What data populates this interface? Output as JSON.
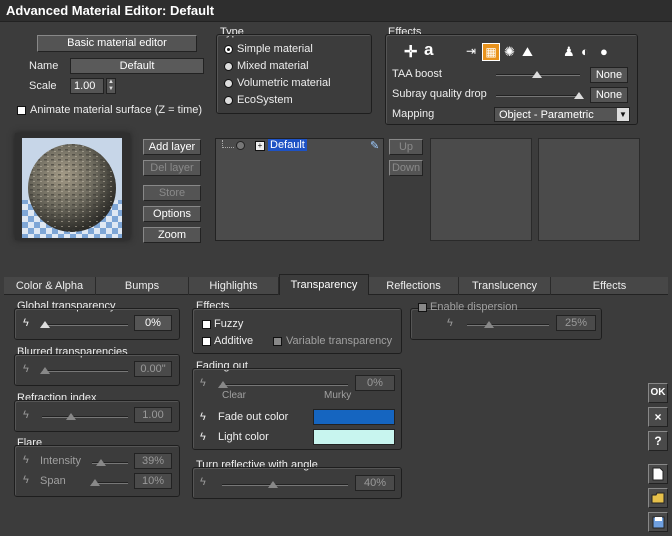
{
  "window": {
    "title": "Advanced Material Editor: Default"
  },
  "basic": {
    "editor_button": "Basic material editor",
    "name_label": "Name",
    "name_value": "Default",
    "scale_label": "Scale",
    "scale_value": "1.00",
    "animate_label": "Animate material surface (Z = time)"
  },
  "type": {
    "title": "Type",
    "options": [
      "Simple material",
      "Mixed material",
      "Volumetric material",
      "EcoSystem"
    ],
    "selected": "Simple material"
  },
  "effects_top": {
    "title": "Effects",
    "taa_label": "TAA boost",
    "taa_value": "None",
    "subray_label": "Subray quality drop",
    "subray_value": "None",
    "mapping_label": "Mapping",
    "mapping_value": "Object - Parametric"
  },
  "layers": {
    "add": "Add layer",
    "del": "Del layer",
    "store": "Store",
    "options": "Options",
    "zoom": "Zoom",
    "tree_item": "Default",
    "up": "Up",
    "down": "Down"
  },
  "tabs": [
    "Color & Alpha",
    "Bumps",
    "Highlights",
    "Transparency",
    "Reflections",
    "Translucency",
    "Effects"
  ],
  "active_tab": "Transparency",
  "global_transparency": {
    "title": "Global transparency",
    "value": "0%",
    "level": 0
  },
  "blurred": {
    "title": "Blurred transparencies",
    "value": "0.00\""
  },
  "refraction": {
    "title": "Refraction index",
    "value": "1.00"
  },
  "flare": {
    "title": "Flare",
    "intensity_label": "Intensity",
    "intensity_value": "39%",
    "span_label": "Span",
    "span_value": "10%"
  },
  "effects": {
    "title": "Effects",
    "fuzzy": "Fuzzy",
    "additive": "Additive",
    "variable": "Variable transparency"
  },
  "dispersion": {
    "label": "Enable dispersion",
    "value": "25%"
  },
  "fading": {
    "title": "Fading out",
    "value": "0%",
    "clear": "Clear",
    "murky": "Murky",
    "fade_color_label": "Fade out color",
    "fade_color": "#1565c0",
    "light_color_label": "Light color",
    "light_color": "#c8f5ef"
  },
  "reflective": {
    "title": "Turn reflective with angle",
    "value": "40%"
  },
  "side": {
    "ok": "OK",
    "close": "×",
    "help": "?"
  }
}
